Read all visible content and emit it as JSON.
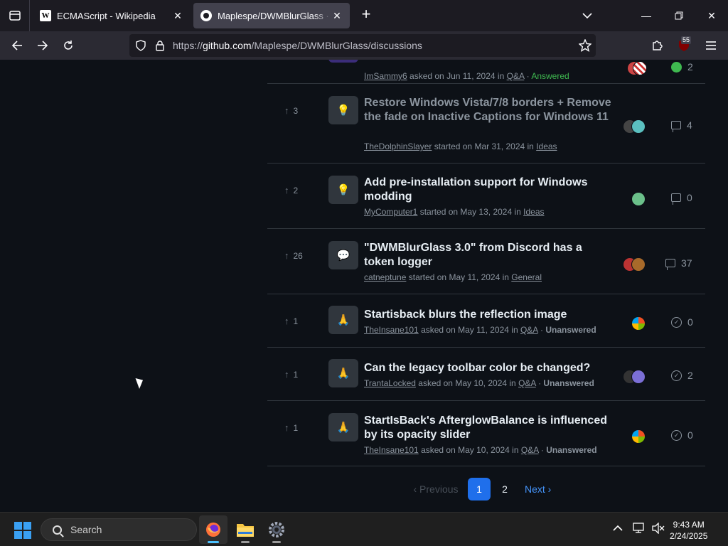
{
  "browser": {
    "tabs": [
      {
        "title": "ECMAScript - Wikipedia",
        "icon": "wikipedia-icon",
        "active": false
      },
      {
        "title": "Maplespe/DWMBlurGlass · Discussions",
        "icon": "github-icon",
        "active": true
      }
    ],
    "url_prefix": "https://",
    "url_host": "github.com",
    "url_path": "/Maplespe/DWMBlurGlass/discussions",
    "extension_badge": "55"
  },
  "discussions": [
    {
      "upvotes": "",
      "title": "",
      "author": "ImSammy6",
      "action": "asked on",
      "date": "Jun 11, 2024",
      "category": "Q&A",
      "status": "Answered",
      "count": "2",
      "count_icon": "check-circle-icon"
    },
    {
      "upvotes": "3",
      "title": "Restore Windows Vista/7/8 borders + Remove the fade on Inactive Captions for Windows 11",
      "author": "TheDolphinSlayer",
      "action": "started on",
      "date": "Mar 31, 2024",
      "category": "Ideas",
      "status": "",
      "count": "4",
      "count_icon": "comment-icon"
    },
    {
      "upvotes": "2",
      "title": "Add pre-installation support for Windows modding",
      "author": "MyComputer1",
      "action": "started on",
      "date": "May 13, 2024",
      "category": "Ideas",
      "status": "",
      "count": "0",
      "count_icon": "comment-icon"
    },
    {
      "upvotes": "26",
      "title": "\"DWMBlurGlass 3.0\" from Discord has a token logger",
      "author": "catneptune",
      "action": "started on",
      "date": "May 11, 2024",
      "category": "General",
      "status": "",
      "count": "37",
      "count_icon": "comment-icon"
    },
    {
      "upvotes": "1",
      "title": "Startisback blurs the reflection image",
      "author": "TheInsane101",
      "action": "asked on",
      "date": "May 11, 2024",
      "category": "Q&A",
      "status": "Unanswered",
      "count": "0",
      "count_icon": "check-circle-icon"
    },
    {
      "upvotes": "1",
      "title": "Can the legacy toolbar color be changed?",
      "author": "TrantaLocked",
      "action": "asked on",
      "date": "May 10, 2024",
      "category": "Q&A",
      "status": "Unanswered",
      "count": "2",
      "count_icon": "check-circle-icon"
    },
    {
      "upvotes": "1",
      "title": "StartIsBack's AfterglowBalance is influenced by its opacity slider",
      "author": "TheInsane101",
      "action": "asked on",
      "date": "May 10, 2024",
      "category": "Q&A",
      "status": "Unanswered",
      "count": "0",
      "count_icon": "check-circle-icon"
    }
  ],
  "pagination": {
    "previous": "Previous",
    "pages": [
      "1",
      "2"
    ],
    "current": "1",
    "next": "Next"
  },
  "taskbar": {
    "search_label": "Search",
    "time": "9:43 AM",
    "date": "2/24/2025"
  },
  "colors": {
    "accent": "#1f6feb",
    "answered": "#3fb950",
    "link": "#4493f8",
    "windows_blue": "#3aa0f3"
  }
}
